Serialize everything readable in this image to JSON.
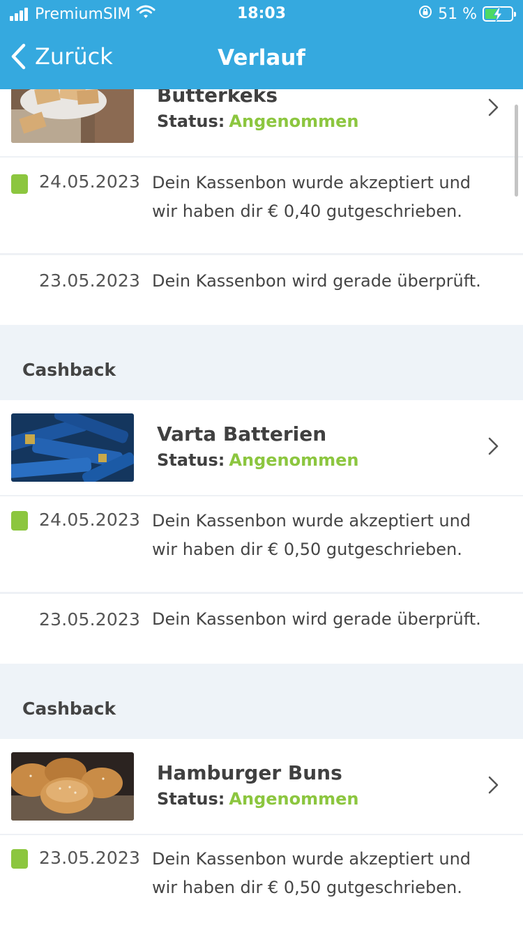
{
  "status_bar": {
    "carrier": "PremiumSIM",
    "time": "18:03",
    "battery_percent": "51 %",
    "battery_level": 0.51
  },
  "nav": {
    "back_label": "Zurück",
    "title": "Verlauf"
  },
  "items": [
    {
      "section_label": "",
      "product_title": "Butterkeks",
      "status_label": "Status:",
      "status_value": "Angenommen",
      "entries": [
        {
          "date": "24.05.2023",
          "text": "Dein Kassenbon wurde akzeptiert und wir haben dir € 0,40 gutgeschrieben.",
          "accepted": true
        },
        {
          "date": "23.05.2023",
          "text": "Dein Kassenbon wird gerade überprüft.",
          "accepted": false
        }
      ]
    },
    {
      "section_label": "Cashback",
      "product_title": "Varta Batterien",
      "status_label": "Status:",
      "status_value": "Angenommen",
      "entries": [
        {
          "date": "24.05.2023",
          "text": "Dein Kassenbon wurde akzeptiert und wir haben dir € 0,50 gutgeschrieben.",
          "accepted": true
        },
        {
          "date": "23.05.2023",
          "text": "Dein Kassenbon wird gerade überprüft.",
          "accepted": false
        }
      ]
    },
    {
      "section_label": "Cashback",
      "product_title": "Hamburger Buns",
      "status_label": "Status:",
      "status_value": "Angenommen",
      "entries": [
        {
          "date": "23.05.2023",
          "text": "Dein Kassenbon wurde akzeptiert und wir haben dir € 0,50 gutgeschrieben.",
          "accepted": true
        }
      ]
    }
  ],
  "colors": {
    "header_blue": "#35a9df",
    "status_green": "#8cc63f",
    "section_bg": "#eef3f8"
  }
}
